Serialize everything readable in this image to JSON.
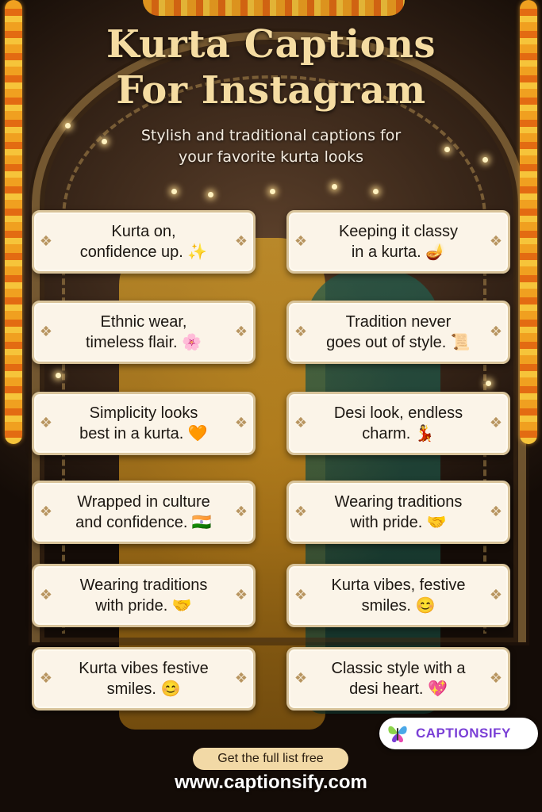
{
  "header": {
    "title_line1": "Kurta Captions",
    "title_line2": "For Instagram",
    "subtitle_line1": "Stylish and traditional captions for",
    "subtitle_line2": "your favorite kurta looks"
  },
  "captions": [
    "Kurta on,\nconfidence up. ✨",
    "Keeping it classy\nin a kurta. 🪔",
    "Ethnic wear,\ntimeless flair. 🌸",
    "Tradition never\ngoes out of style. 📜",
    "Simplicity looks\nbest in a kurta. 🧡",
    "Desi look, endless\ncharm. 💃",
    "Wrapped in culture\nand confidence. 🇮🇳",
    "Wearing traditions\nwith pride. 🤝",
    "Wearing traditions\nwith pride. 🤝",
    "Kurta vibes, festive\nsmiles. 😊",
    "Kurta vibes festive\nsmiles. 😊",
    "Classic style with a\ndesi heart. 💖"
  ],
  "footer": {
    "cta_label": "Get the full list free",
    "url": "www.captionsify.com",
    "brand_name": "CAPTIONSIFY"
  },
  "colors": {
    "title": "#f5dca2",
    "card_background": "#fbf4e8",
    "card_border": "#d8c39a",
    "cta_background": "#f2d9a6",
    "brand_purple": "#7a3fd6"
  },
  "icons": {
    "card_ornament": "ornament-icon",
    "brand_logo": "butterfly-logo-icon"
  }
}
